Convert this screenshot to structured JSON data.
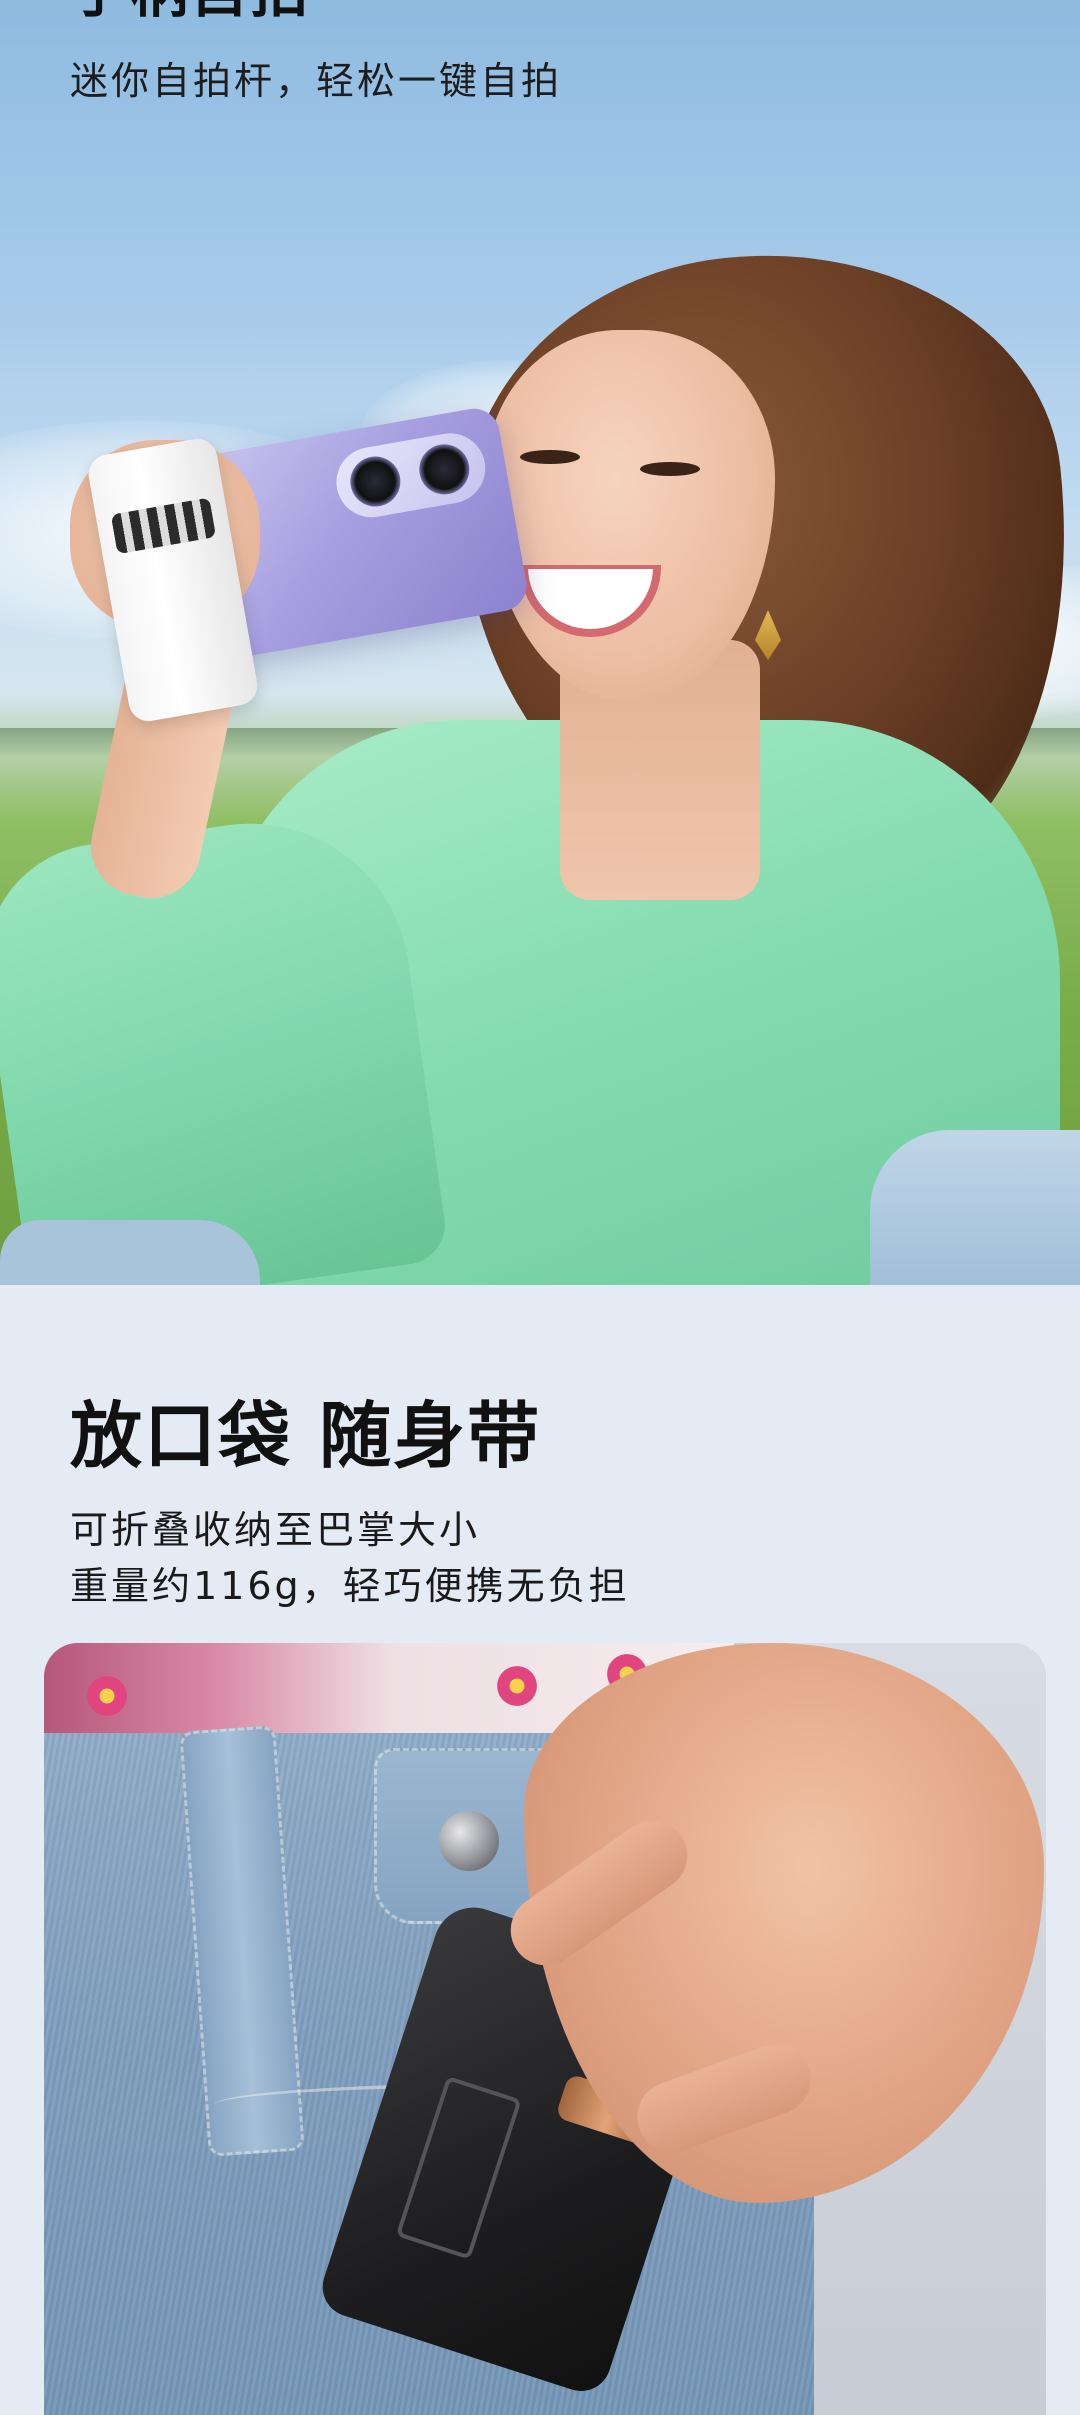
{
  "hero": {
    "title": "手柄自拍",
    "subtitle": "迷你自拍杆，轻松一键自拍"
  },
  "section2": {
    "title": "放口袋 随身带",
    "description_lines": [
      "可折叠收纳至巴掌大小",
      "重量约116g，轻巧便携无负担"
    ]
  }
}
